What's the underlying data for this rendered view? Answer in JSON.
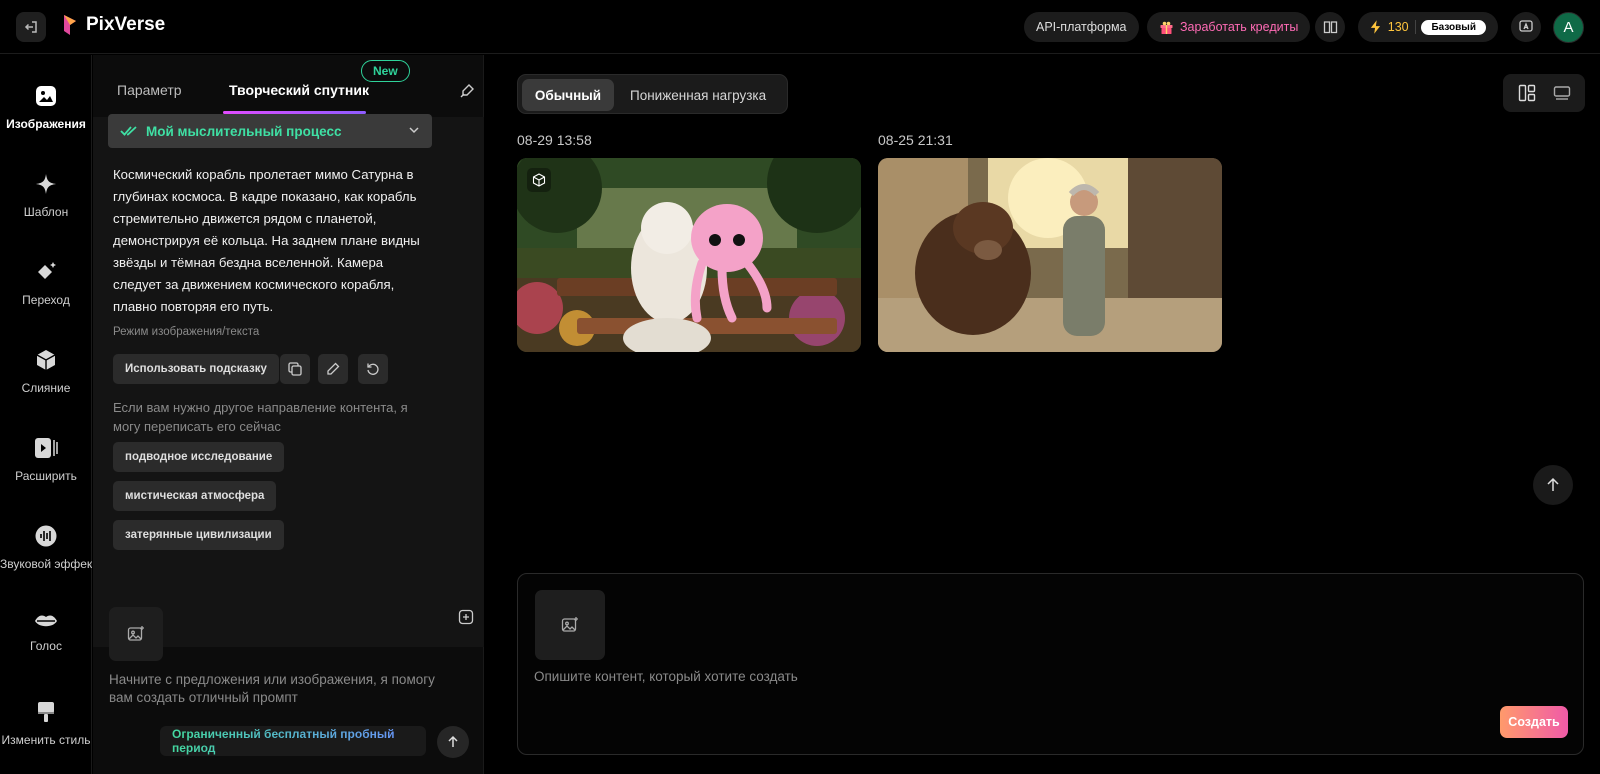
{
  "app": {
    "name": "PixVerse"
  },
  "header": {
    "api_label": "API-платформа",
    "earn_label": "Заработать кредиты",
    "credits": "130",
    "plan": "Базовый",
    "avatar_letter": "A"
  },
  "sidebar": {
    "items": [
      {
        "label": "Изображения",
        "icon": "image-icon"
      },
      {
        "label": "Шаблон",
        "icon": "sparkle-icon"
      },
      {
        "label": "Переход",
        "icon": "transition-icon"
      },
      {
        "label": "Слияние",
        "icon": "cube-icon"
      },
      {
        "label": "Расширить",
        "icon": "video-extend-icon"
      },
      {
        "label": "Звуковой эффект",
        "icon": "audio-wave-icon"
      },
      {
        "label": "Голос",
        "icon": "lips-icon"
      },
      {
        "label": "Изменить стиль",
        "icon": "brush-icon"
      }
    ]
  },
  "panel": {
    "tabs": {
      "parameter": "Параметр",
      "creative": "Творческий спутник",
      "new_badge": "New"
    },
    "thinking_label": "Мой мыслительный процесс",
    "description": "Космический корабль пролетает мимо Сатурна в глубинах космоса. В кадре показано, как корабль стремительно движется рядом с планетой, демонстрируя её кольца. На заднем плане видны звёзды и тёмная бездна вселенной. Камера следует за движением космического корабля, плавно повторяя его путь.",
    "mode": "Режим изображения/текста",
    "use_prompt": "Использовать подсказку",
    "rewrite_hint": "Если вам нужно другое направление контента, я могу переписать его сейчас",
    "suggestions": [
      "подводное исследование",
      "мистическая атмосфера",
      "затерянные цивилизации"
    ],
    "prompt_placeholder": "Начните с предложения или изображения, я помогу вам создать отличный промпт",
    "trial": "Ограниченный бесплатный пробный период"
  },
  "main": {
    "segments": {
      "normal": "Обычный",
      "low_load": "Пониженная нагрузка"
    },
    "dates": [
      "08-29 13:58",
      "08-25 21:31"
    ],
    "composer_placeholder": "Опишите контент, который хотите создать",
    "create_label": "Создать"
  },
  "colors": {
    "accent_green": "#3fe0a4",
    "brand_gradient_start": "#ff9a6b",
    "brand_gradient_end": "#f05aa8"
  }
}
